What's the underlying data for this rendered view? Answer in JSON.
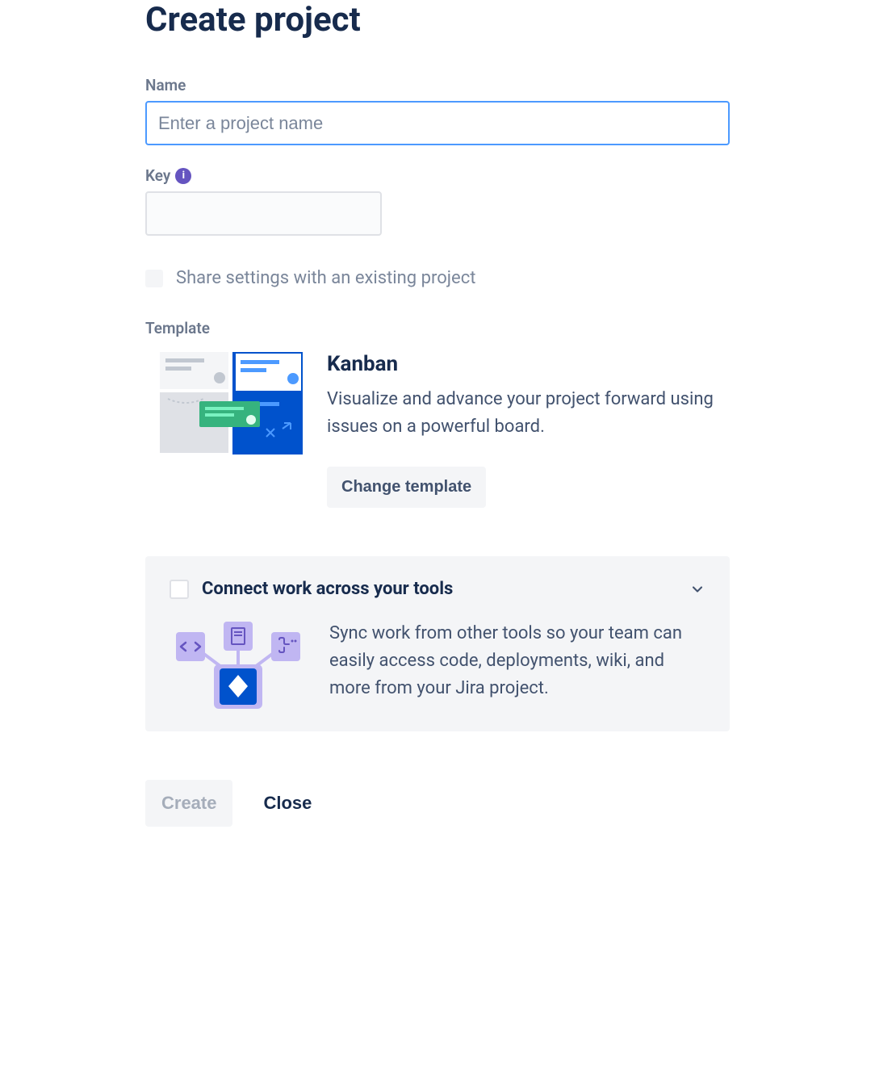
{
  "heading": "Create project",
  "form": {
    "name_label": "Name",
    "name_placeholder": "Enter a project name",
    "name_value": "",
    "key_label": "Key",
    "key_value": "",
    "share_settings_label": "Share settings with an existing project"
  },
  "template": {
    "section_label": "Template",
    "name": "Kanban",
    "description": "Visualize and advance your project forward using issues on a powerful board.",
    "change_button": "Change template"
  },
  "connect": {
    "title": "Connect work across your tools",
    "description": "Sync work from other tools so your team can easily access code, deployments, wiki, and more from your Jira project."
  },
  "buttons": {
    "create": "Create",
    "close": "Close"
  }
}
